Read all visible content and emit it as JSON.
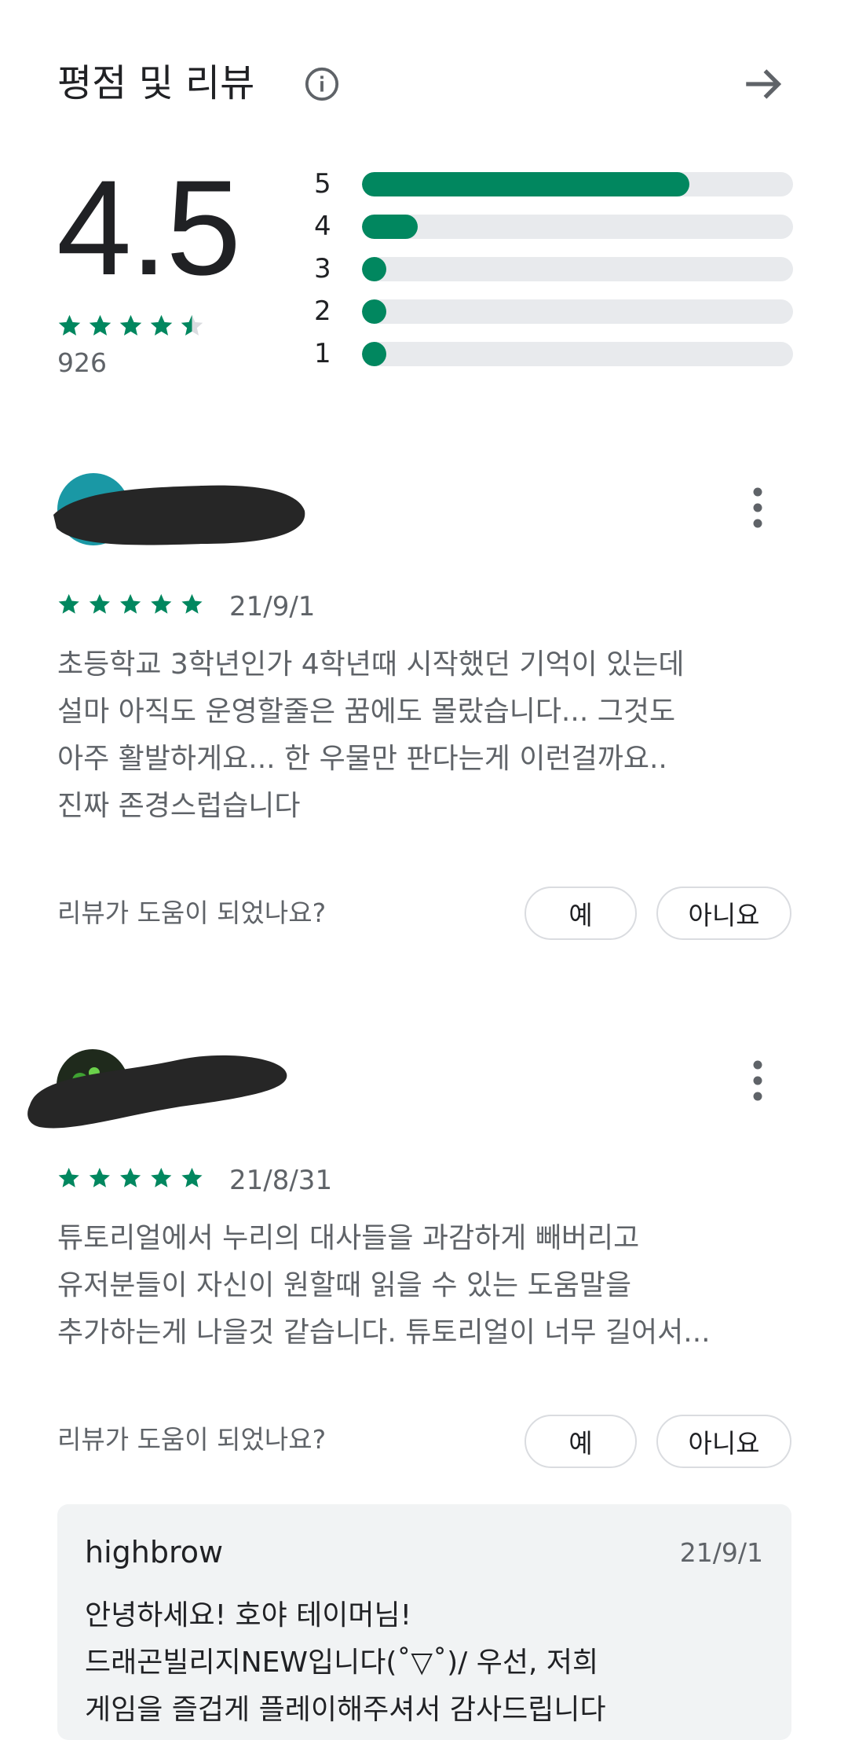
{
  "header": {
    "title": "평점 및 리뷰",
    "info_icon": "info-icon",
    "arrow_icon": "arrow-right-icon"
  },
  "summary": {
    "average": "4.5",
    "average_value": 4.5,
    "count": "926",
    "distribution": [
      {
        "label": "5",
        "fraction": 0.76
      },
      {
        "label": "4",
        "fraction": 0.13
      },
      {
        "label": "3",
        "fraction": 0.04
      },
      {
        "label": "2",
        "fraction": 0.04
      },
      {
        "label": "1",
        "fraction": 0.04
      }
    ]
  },
  "colors": {
    "accent": "#01875f",
    "track": "#e8eaed",
    "avatar1": "#1a98a5"
  },
  "reviews": [
    {
      "stars": 5,
      "date": "21/9/1",
      "text": "초등학교 3학년인가 4학년때 시작했던 기억이 있는데\n설마 아직도 운영할줄은 꿈에도 몰랐습니다... 그것도\n아주 활발하게요... 한 우물만 판다는게 이런걸까요..\n진짜 존경스럽습니다",
      "helpful_question": "리뷰가 도움이 되었나요?",
      "yes_label": "예",
      "no_label": "아니요"
    },
    {
      "stars": 5,
      "date": "21/8/31",
      "text": "튜토리얼에서 누리의 대사들을 과감하게 빼버리고\n유저분들이 자신이 원할때 읽을 수 있는 도움말을\n추가하는게 나을것 같습니다. 튜토리얼이 너무 길어서...",
      "helpful_question": "리뷰가 도움이 되었나요?",
      "yes_label": "예",
      "no_label": "아니요"
    }
  ],
  "developer_reply": {
    "name": "highbrow",
    "date": "21/9/1",
    "text": "안녕하세요! 호야 테이머님!\n드래곤빌리지NEW입니다(˚▽˚)/ 우선, 저희\n게임을 즐겁게 플레이해주셔서 감사드립니다"
  }
}
